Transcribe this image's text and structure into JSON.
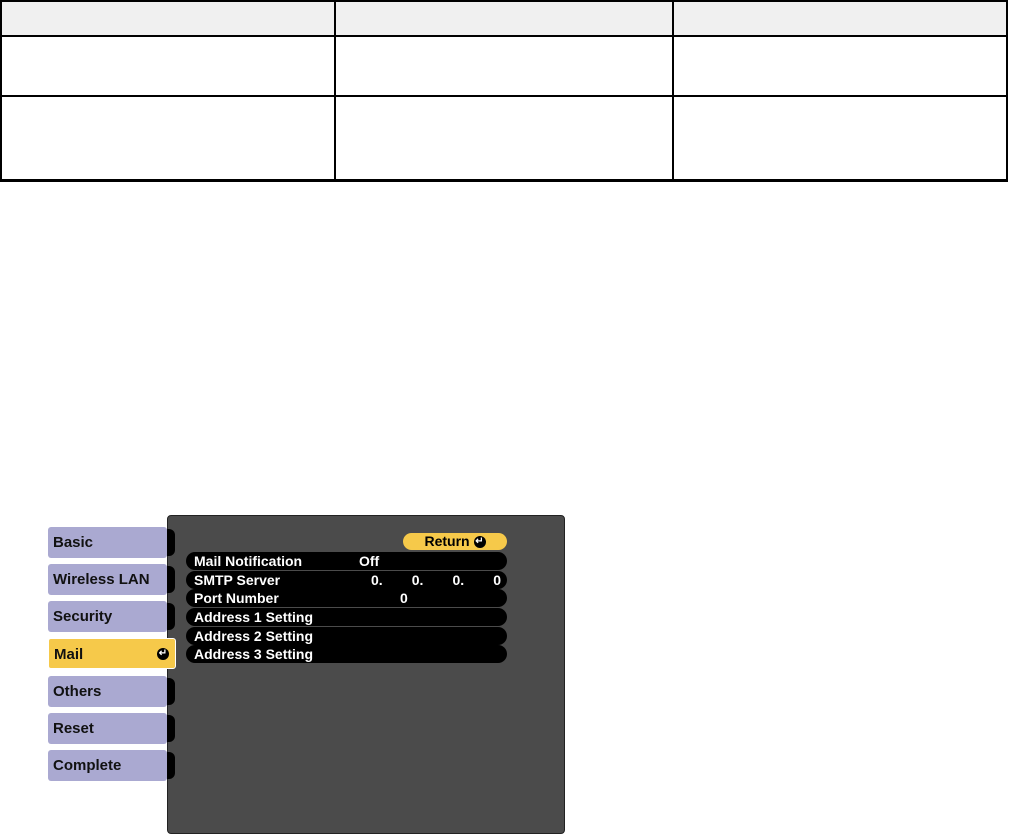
{
  "tabs": [
    "Basic",
    "Wireless LAN",
    "Security",
    "Mail",
    "Others",
    "Reset",
    "Complete"
  ],
  "active_tab": "Mail",
  "return_label": "Return",
  "rows": [
    {
      "label": "Mail Notification",
      "value": "Off"
    },
    {
      "label": "SMTP Server",
      "ip": [
        "0.",
        "0.",
        "0.",
        "0"
      ]
    },
    {
      "label": "Port Number",
      "value": "0"
    },
    {
      "label": "Address 1 Setting"
    },
    {
      "label": "Address 2 Setting"
    },
    {
      "label": "Address 3 Setting"
    }
  ],
  "colors": {
    "tab": "#aaa9d1",
    "active": "#f6c94a",
    "panel": "#4b4b4b"
  }
}
